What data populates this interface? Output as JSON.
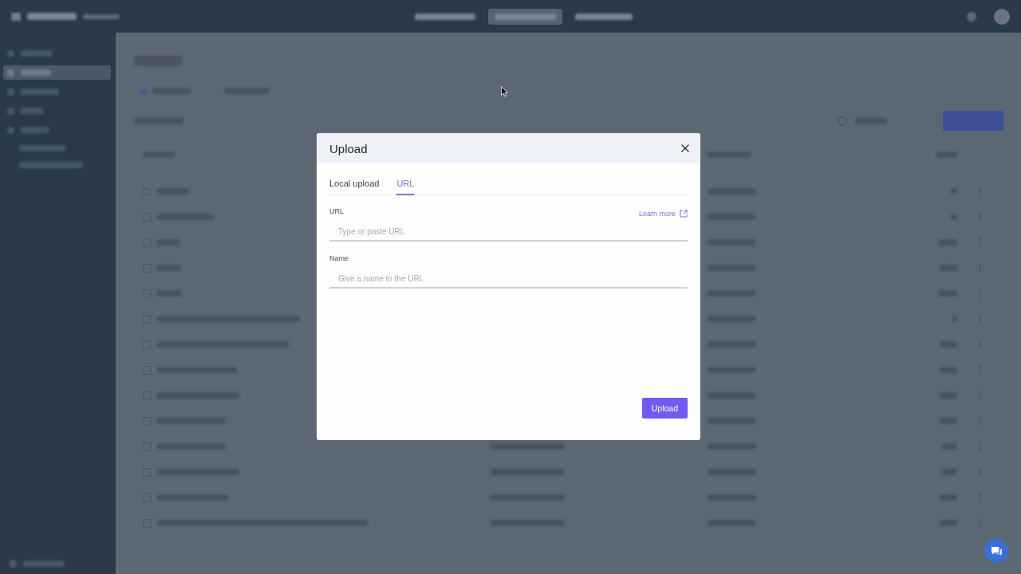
{
  "background": {
    "nav_items": [
      {
        "selected": false
      },
      {
        "selected": true
      },
      {
        "selected": false
      }
    ],
    "sidebar_items": [
      {
        "kind": "item",
        "selected": false
      },
      {
        "kind": "item",
        "selected": true
      },
      {
        "kind": "item",
        "selected": false
      },
      {
        "kind": "item",
        "selected": false
      },
      {
        "kind": "item",
        "selected": false
      },
      {
        "kind": "subitem",
        "selected": false
      },
      {
        "kind": "subitem",
        "selected": false
      }
    ]
  },
  "dialog": {
    "title": "Upload",
    "tabs": [
      {
        "label": "Local upload",
        "selected": false
      },
      {
        "label": "URL",
        "selected": true
      }
    ],
    "fields": [
      {
        "label": "URL",
        "placeholder": "Type or paste URL",
        "link": "Learn more"
      },
      {
        "label": "Name",
        "placeholder": "Give a name to the URL"
      }
    ],
    "submit_button": "Upload"
  }
}
